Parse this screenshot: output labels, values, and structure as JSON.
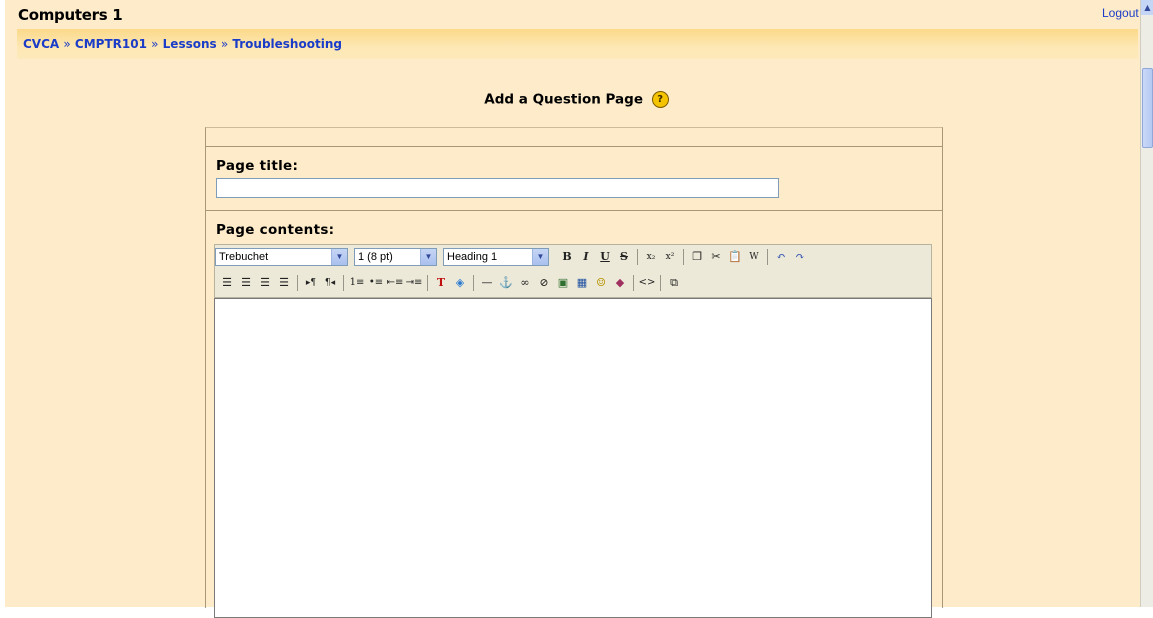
{
  "site": {
    "title": "Computers 1",
    "logout_label": "Logout"
  },
  "breadcrumb": {
    "items": [
      "CVCA",
      "CMPTR101",
      "Lessons",
      "Troubleshooting"
    ],
    "separator": "»"
  },
  "page": {
    "heading": "Add a Question Page",
    "help_icon": "help-icon"
  },
  "form": {
    "page_title_label": "Page title",
    "page_title_value": "",
    "page_contents_label": "Page contents"
  },
  "editor": {
    "font_family": "Trebuchet",
    "font_size": "1 (8 pt)",
    "block_format": "Heading 1",
    "row1_icons": [
      "bold-icon",
      "italic-icon",
      "underline-icon",
      "strikethrough-icon",
      "subscript-icon",
      "superscript-icon",
      "copy-icon",
      "cut-icon",
      "paste-icon",
      "paste-word-icon",
      "undo-icon",
      "redo-icon"
    ],
    "row2_icons": [
      "align-left-icon",
      "align-center-icon",
      "align-right-icon",
      "justify-icon",
      "ltr-icon",
      "rtl-icon",
      "ordered-list-icon",
      "unordered-list-icon",
      "outdent-icon",
      "indent-icon",
      "text-color-icon",
      "background-color-icon",
      "horizontal-rule-icon",
      "anchor-icon",
      "link-icon",
      "unlink-icon",
      "image-icon",
      "table-icon",
      "smiley-icon",
      "special-char-icon",
      "html-source-icon",
      "fullscreen-icon"
    ]
  },
  "colors": {
    "page_background": "#fdebc9",
    "navbar": "#fbd98a",
    "link": "#1a3cc8"
  }
}
